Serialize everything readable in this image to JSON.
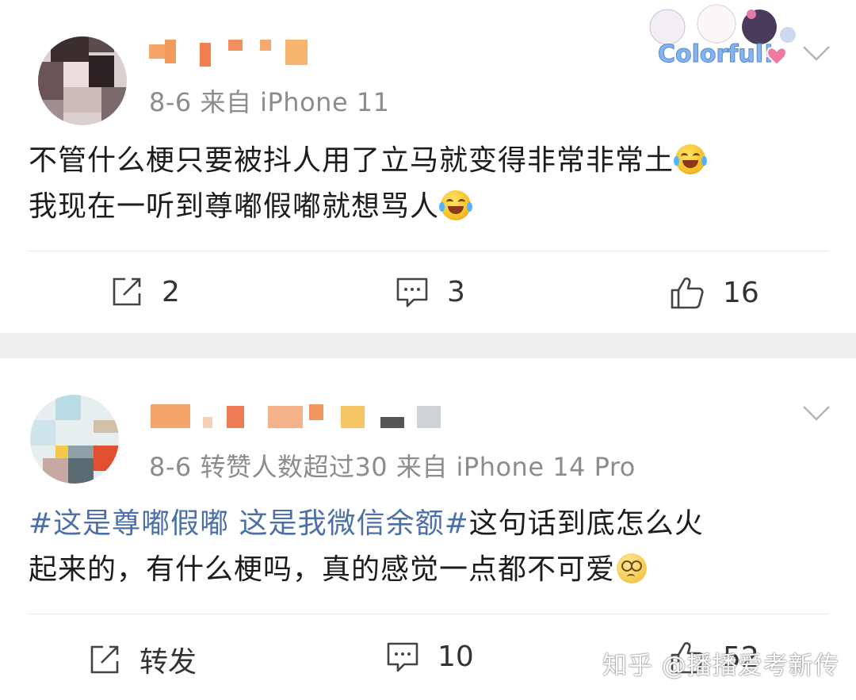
{
  "posts": [
    {
      "meta": "8-6  来自 iPhone 11",
      "content_lines": [
        "不管什么梗只要被抖人用了立马就变得非常非常土",
        "我现在一听到尊嘟假嘟就想骂人"
      ],
      "actions": {
        "repost": "2",
        "comment": "3",
        "like": "16"
      }
    },
    {
      "meta": "8-6 转赞人数超过30  来自 iPhone 14 Pro",
      "content": {
        "topic": "#这是尊嘟假嘟 这是我微信余额#",
        "line1_rest": "这句话到底怎么火",
        "line2": "起来的，有什么梗吗，真的感觉一点都不可爱"
      },
      "actions": {
        "repost": "转发",
        "comment": "10",
        "like": "52"
      }
    }
  ],
  "watermark": {
    "logo_text": "Colorful!",
    "text": "知乎 @播播爱考新传"
  },
  "colors": {
    "topic": "#4b6fa6",
    "meta": "#8c8c8c",
    "separator": "#efeff1"
  }
}
